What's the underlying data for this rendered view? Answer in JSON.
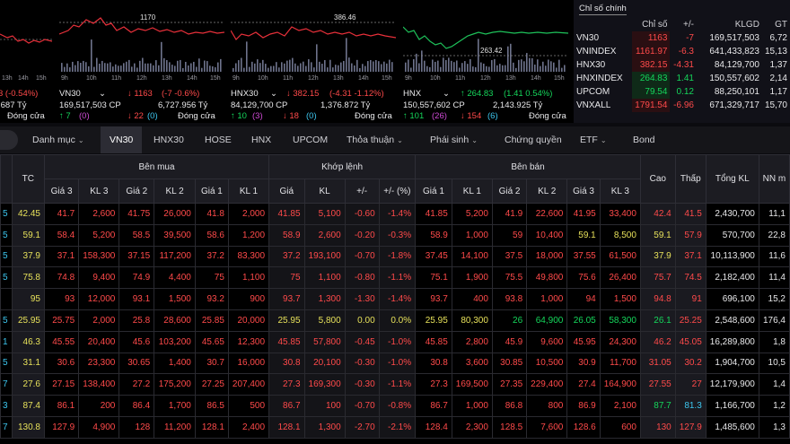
{
  "colors": {
    "up": "#15d65b",
    "down": "#ff4a4a",
    "ref": "#e6e05a",
    "ceil": "#d04bd6",
    "floor": "#3dc7f0",
    "white": "#e8e8ea"
  },
  "mini_charts": [
    {
      "id": "p0",
      "ref_label": "",
      "ticks": [
        "13h",
        "14h",
        "15h"
      ],
      "row1": {
        "name": "",
        "price": "",
        "change": "3 (-0.54%)"
      },
      "row2": {
        "volume": "",
        "value": ".687 Tỷ",
        "extra": ""
      },
      "row3": {
        "up": "",
        "ceil": "",
        "down": "",
        "floor": "",
        "status": "Đóng cửa"
      }
    },
    {
      "id": "p1",
      "ref_label": "1170",
      "ticks": [
        "9h",
        "10h",
        "11h",
        "12h",
        "13h",
        "14h",
        "15h"
      ],
      "row1": {
        "name": "VN30",
        "price": "↓ 1163",
        "change": "(-7 -0.6%)"
      },
      "row2": {
        "volume": "169,517,503 CP",
        "value": "6,727.956 Tỷ",
        "extra": ""
      },
      "row3": {
        "up": "↑ 7",
        "ceil": "(0)",
        "down": "↓ 22",
        "floor": "(0)",
        "status": "Đóng cửa"
      }
    },
    {
      "id": "p2",
      "ref_label": "386.46",
      "ticks": [
        "9h",
        "10h",
        "11h",
        "12h",
        "13h",
        "14h",
        "15h"
      ],
      "row1": {
        "name": "HNX30",
        "price": "↓ 382.15",
        "change": "(-4.31 -1.12%)"
      },
      "row2": {
        "volume": "84,129,700 CP",
        "value": "1,376.872 Tỷ",
        "extra": ""
      },
      "row3": {
        "up": "↑ 10",
        "ceil": "(3)",
        "down": "↓ 18",
        "floor": "(0)",
        "status": "Đóng cửa"
      }
    },
    {
      "id": "p3",
      "ref_label": "263.42",
      "ticks": [
        "9h",
        "10h",
        "11h",
        "12h",
        "13h",
        "14h",
        "15h"
      ],
      "row1": {
        "name": "HNX",
        "price": "↑ 264.83",
        "change": "(1.41 0.54%)"
      },
      "row2": {
        "volume": "150,557,602 CP",
        "value": "2,143.925 Tỷ",
        "extra": ""
      },
      "row3": {
        "up": "↑ 101",
        "ceil": "(26)",
        "down": "↓ 154",
        "floor": "(6)",
        "status": "Đóng cửa"
      }
    }
  ],
  "index_table": {
    "title": "Chỉ số chính",
    "headers": [
      "Chỉ số",
      "+/-",
      "KLGD",
      "GT"
    ],
    "rows": [
      {
        "name": "VN30",
        "value": "1163",
        "change": "-7",
        "volume": "169,517,503",
        "gt": "6,72",
        "dir": "down"
      },
      {
        "name": "VNINDEX",
        "value": "1161.97",
        "change": "-6.3",
        "volume": "641,433,823",
        "gt": "15,13",
        "dir": "down"
      },
      {
        "name": "HNX30",
        "value": "382.15",
        "change": "-4.31",
        "volume": "84,129,700",
        "gt": "1,37",
        "dir": "down"
      },
      {
        "name": "HNXINDEX",
        "value": "264.83",
        "change": "1.41",
        "volume": "150,557,602",
        "gt": "2,14",
        "dir": "up"
      },
      {
        "name": "UPCOM",
        "value": "79.54",
        "change": "0.12",
        "volume": "88,250,101",
        "gt": "1,17",
        "dir": "up"
      },
      {
        "name": "VNXALL",
        "value": "1791.54",
        "change": "-6.96",
        "volume": "671,329,717",
        "gt": "15,70",
        "dir": "down"
      }
    ]
  },
  "tabs": [
    {
      "label": "Danh mục",
      "caret": "⌄",
      "active": false
    },
    {
      "label": "VN30",
      "caret": "",
      "active": true
    },
    {
      "label": "HNX30",
      "caret": "",
      "active": false
    },
    {
      "label": "HOSE",
      "caret": "",
      "active": false
    },
    {
      "label": "HNX",
      "caret": "",
      "active": false
    },
    {
      "label": "UPCOM",
      "caret": "",
      "active": false
    },
    {
      "label": "Thỏa thuận",
      "caret": "⌄",
      "active": false
    },
    {
      "label": "Phái sinh",
      "caret": "⌄",
      "active": false
    },
    {
      "label": "Chứng quyền",
      "caret": "",
      "active": false
    },
    {
      "label": "ETF",
      "caret": "⌄",
      "active": false
    },
    {
      "label": "Bond",
      "caret": "",
      "active": false
    }
  ],
  "board": {
    "group_headers": {
      "tc": "TC",
      "buy": "Bên mua",
      "match": "Khớp lệnh",
      "sell": "Bên bán",
      "high": "Cao",
      "low": "Thấp",
      "total": "Tổng KL",
      "foreign": "NN m"
    },
    "sub_headers": [
      "Giá 3",
      "KL 3",
      "Giá 2",
      "KL 2",
      "Giá 1",
      "KL 1",
      "Giá",
      "KL",
      "+/-",
      "+/- (%)",
      "Giá 1",
      "KL 1",
      "Giá 2",
      "KL 2",
      "Giá 3",
      "KL 3"
    ],
    "rows": [
      {
        "sym": "5",
        "tc": "42.45",
        "b3p": "41.7",
        "b3v": "2,600",
        "b2p": "41.75",
        "b2v": "26,000",
        "b1p": "41.8",
        "b1v": "2,000",
        "mp": "41.85",
        "mv": "5,100",
        "ch": "-0.60",
        "pc": "-1.4%",
        "s1p": "41.85",
        "s1v": "5,200",
        "s2p": "41.9",
        "s2v": "22,600",
        "s3p": "41.95",
        "s3v": "33,400",
        "hi": "42.4",
        "lo": "41.5",
        "tot": "2,430,700",
        "nn": "11,1",
        "c": {
          "b3": "r",
          "b2": "r",
          "b1": "r",
          "m": "r",
          "s1": "r",
          "s2": "r",
          "s3": "r",
          "hi": "r",
          "lo": "r"
        }
      },
      {
        "sym": "5",
        "tc": "59.1",
        "b3p": "58.4",
        "b3v": "5,200",
        "b2p": "58.5",
        "b2v": "39,500",
        "b1p": "58.6",
        "b1v": "1,200",
        "mp": "58.9",
        "mv": "2,600",
        "ch": "-0.20",
        "pc": "-0.3%",
        "s1p": "58.9",
        "s1v": "1,000",
        "s2p": "59",
        "s2v": "10,400",
        "s3p": "59.1",
        "s3v": "8,500",
        "hi": "59.1",
        "lo": "57.9",
        "tot": "570,700",
        "nn": "22,8",
        "c": {
          "b3": "r",
          "b2": "r",
          "b1": "r",
          "m": "r",
          "s1": "r",
          "s2": "r",
          "s3": "y",
          "hi": "y",
          "lo": "r"
        }
      },
      {
        "sym": "5",
        "tc": "37.9",
        "b3p": "37.1",
        "b3v": "158,300",
        "b2p": "37.15",
        "b2v": "117,200",
        "b1p": "37.2",
        "b1v": "83,300",
        "mp": "37.2",
        "mv": "193,100",
        "ch": "-0.70",
        "pc": "-1.8%",
        "s1p": "37.45",
        "s1v": "14,100",
        "s2p": "37.5",
        "s2v": "18,000",
        "s3p": "37.55",
        "s3v": "61,500",
        "hi": "37.9",
        "lo": "37.1",
        "tot": "10,113,900",
        "nn": "11,6",
        "c": {
          "b3": "r",
          "b2": "r",
          "b1": "r",
          "m": "r",
          "s1": "r",
          "s2": "r",
          "s3": "r",
          "hi": "y",
          "lo": "r"
        }
      },
      {
        "sym": "5",
        "tc": "75.8",
        "b3p": "74.8",
        "b3v": "9,400",
        "b2p": "74.9",
        "b2v": "4,400",
        "b1p": "75",
        "b1v": "1,100",
        "mp": "75",
        "mv": "1,100",
        "ch": "-0.80",
        "pc": "-1.1%",
        "s1p": "75.1",
        "s1v": "1,900",
        "s2p": "75.5",
        "s2v": "49,800",
        "s3p": "75.6",
        "s3v": "26,400",
        "hi": "75.7",
        "lo": "74.5",
        "tot": "2,182,400",
        "nn": "11,4",
        "c": {
          "b3": "r",
          "b2": "r",
          "b1": "r",
          "m": "r",
          "s1": "r",
          "s2": "r",
          "s3": "r",
          "hi": "r",
          "lo": "r"
        }
      },
      {
        "sym": "",
        "tc": "95",
        "b3p": "93",
        "b3v": "12,000",
        "b2p": "93.1",
        "b2v": "1,500",
        "b1p": "93.2",
        "b1v": "900",
        "mp": "93.7",
        "mv": "1,300",
        "ch": "-1.30",
        "pc": "-1.4%",
        "s1p": "93.7",
        "s1v": "400",
        "s2p": "93.8",
        "s2v": "1,000",
        "s3p": "94",
        "s3v": "1,500",
        "hi": "94.8",
        "lo": "91",
        "tot": "696,100",
        "nn": "15,2",
        "c": {
          "b3": "r",
          "b2": "r",
          "b1": "r",
          "m": "r",
          "s1": "r",
          "s2": "r",
          "s3": "r",
          "hi": "r",
          "lo": "r"
        }
      },
      {
        "sym": "5",
        "tc": "25.95",
        "b3p": "25.75",
        "b3v": "2,000",
        "b2p": "25.8",
        "b2v": "28,600",
        "b1p": "25.85",
        "b1v": "20,000",
        "mp": "25.95",
        "mv": "5,800",
        "ch": "0.00",
        "pc": "0.0%",
        "s1p": "25.95",
        "s1v": "80,300",
        "s2p": "26",
        "s2v": "64,900",
        "s3p": "26.05",
        "s3v": "58,300",
        "hi": "26.1",
        "lo": "25.25",
        "tot": "2,548,600",
        "nn": "176,4",
        "c": {
          "b3": "r",
          "b2": "r",
          "b1": "r",
          "m": "y",
          "s1": "y",
          "s2": "g",
          "s3": "g",
          "hi": "g",
          "lo": "r"
        }
      },
      {
        "sym": "1",
        "tc": "46.3",
        "b3p": "45.55",
        "b3v": "20,400",
        "b2p": "45.6",
        "b2v": "103,200",
        "b1p": "45.65",
        "b1v": "12,300",
        "mp": "45.85",
        "mv": "57,800",
        "ch": "-0.45",
        "pc": "-1.0%",
        "s1p": "45.85",
        "s1v": "2,800",
        "s2p": "45.9",
        "s2v": "9,600",
        "s3p": "45.95",
        "s3v": "24,300",
        "hi": "46.2",
        "lo": "45.05",
        "tot": "16,289,800",
        "nn": "1,8",
        "c": {
          "b3": "r",
          "b2": "r",
          "b1": "r",
          "m": "r",
          "s1": "r",
          "s2": "r",
          "s3": "r",
          "hi": "r",
          "lo": "r"
        }
      },
      {
        "sym": "5",
        "tc": "31.1",
        "b3p": "30.6",
        "b3v": "23,300",
        "b2p": "30.65",
        "b2v": "1,400",
        "b1p": "30.7",
        "b1v": "16,000",
        "mp": "30.8",
        "mv": "20,100",
        "ch": "-0.30",
        "pc": "-1.0%",
        "s1p": "30.8",
        "s1v": "3,600",
        "s2p": "30.85",
        "s2v": "10,500",
        "s3p": "30.9",
        "s3v": "11,700",
        "hi": "31.05",
        "lo": "30.2",
        "tot": "1,904,700",
        "nn": "10,5",
        "c": {
          "b3": "r",
          "b2": "r",
          "b1": "r",
          "m": "r",
          "s1": "r",
          "s2": "r",
          "s3": "r",
          "hi": "r",
          "lo": "r"
        }
      },
      {
        "sym": "7",
        "tc": "27.6",
        "b3p": "27.15",
        "b3v": "138,400",
        "b2p": "27.2",
        "b2v": "175,200",
        "b1p": "27.25",
        "b1v": "207,400",
        "mp": "27.3",
        "mv": "169,300",
        "ch": "-0.30",
        "pc": "-1.1%",
        "s1p": "27.3",
        "s1v": "169,500",
        "s2p": "27.35",
        "s2v": "229,400",
        "s3p": "27.4",
        "s3v": "164,900",
        "hi": "27.55",
        "lo": "27",
        "tot": "12,179,900",
        "nn": "1,4",
        "c": {
          "b3": "r",
          "b2": "r",
          "b1": "r",
          "m": "r",
          "s1": "r",
          "s2": "r",
          "s3": "r",
          "hi": "r",
          "lo": "r"
        }
      },
      {
        "sym": "3",
        "tc": "87.4",
        "b3p": "86.1",
        "b3v": "200",
        "b2p": "86.4",
        "b2v": "1,700",
        "b1p": "86.5",
        "b1v": "500",
        "mp": "86.7",
        "mv": "100",
        "ch": "-0.70",
        "pc": "-0.8%",
        "s1p": "86.7",
        "s1v": "1,000",
        "s2p": "86.8",
        "s2v": "800",
        "s3p": "86.9",
        "s3v": "2,100",
        "hi": "87.7",
        "lo": "81.3",
        "tot": "1,166,700",
        "nn": "1,2",
        "c": {
          "b3": "r",
          "b2": "r",
          "b1": "r",
          "m": "r",
          "s1": "r",
          "s2": "r",
          "s3": "r",
          "hi": "g",
          "lo": "c"
        }
      },
      {
        "sym": "7",
        "tc": "130.8",
        "b3p": "127.9",
        "b3v": "4,900",
        "b2p": "128",
        "b2v": "11,200",
        "b1p": "128.1",
        "b1v": "2,400",
        "mp": "128.1",
        "mv": "1,300",
        "ch": "-2.70",
        "pc": "-2.1%",
        "s1p": "128.4",
        "s1v": "2,300",
        "s2p": "128.5",
        "s2v": "7,600",
        "s3p": "128.6",
        "s3v": "600",
        "hi": "130",
        "lo": "127.9",
        "tot": "1,485,600",
        "nn": "1,3",
        "c": {
          "b3": "r",
          "b2": "r",
          "b1": "r",
          "m": "r",
          "s1": "r",
          "s2": "r",
          "s3": "r",
          "hi": "r",
          "lo": "r"
        }
      }
    ]
  }
}
